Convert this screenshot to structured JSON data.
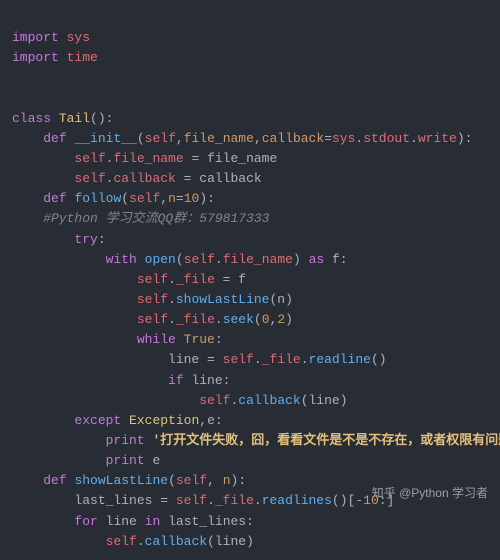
{
  "code": {
    "l1_kw1": "import",
    "l1_mod": "sys",
    "l2_kw1": "import",
    "l2_mod": "time",
    "l4_kw": "class",
    "l4_name": "Tail",
    "l4_p": "():",
    "l5_kw": "def",
    "l5_name": "__init__",
    "l5_sig1": "(",
    "l5_self": "self",
    "l5_c1": ",",
    "l5_p1": "file_name",
    "l5_c2": ",",
    "l5_p2": "callback",
    "l5_eq": "=",
    "l5_sys": "sys",
    "l5_d1": ".",
    "l5_stdout": "stdout",
    "l5_d2": ".",
    "l5_write": "write",
    "l5_end": "):",
    "l6_self": "self",
    "l6_d": ".",
    "l6_attr": "file_name",
    "l6_eq": " = ",
    "l6_val": "file_name",
    "l7_self": "self",
    "l7_d": ".",
    "l7_attr": "callback",
    "l7_eq": " = ",
    "l7_val": "callback",
    "l8_kw": "def",
    "l8_name": "follow",
    "l8_sig1": "(",
    "l8_self": "self",
    "l8_c": ",",
    "l8_p": "n",
    "l8_eq": "=",
    "l8_num": "10",
    "l8_end": "):",
    "l9_cmt": "#Python 学习交流QQ群：579817333",
    "l10_kw": "try",
    "l10_c": ":",
    "l11_kw1": "with",
    "l11_open": "open",
    "l11_p1": "(",
    "l11_self": "self",
    "l11_d": ".",
    "l11_attr": "file_name",
    "l11_p2": ")",
    "l11_kw2": "as",
    "l11_f": "f",
    "l11_c": ":",
    "l12_self": "self",
    "l12_d": ".",
    "l12_attr": "_file",
    "l12_eq": " = ",
    "l12_val": "f",
    "l13_self": "self",
    "l13_d": ".",
    "l13_fn": "showLastLine",
    "l13_p": "(n)",
    "l14_self": "self",
    "l14_d1": ".",
    "l14_attr": "_file",
    "l14_d2": ".",
    "l14_fn": "seek",
    "l14_p1": "(",
    "l14_n1": "0",
    "l14_c": ",",
    "l14_n2": "2",
    "l14_p2": ")",
    "l15_kw": "while",
    "l15_bool": "True",
    "l15_c": ":",
    "l16_var": "line",
    "l16_eq": " = ",
    "l16_self": "self",
    "l16_d1": ".",
    "l16_attr": "_file",
    "l16_d2": ".",
    "l16_fn": "readline",
    "l16_p": "()",
    "l17_kw": "if",
    "l17_var": "line",
    "l17_c": ":",
    "l18_self": "self",
    "l18_d": ".",
    "l18_fn": "callback",
    "l18_p": "(line)",
    "l19_kw": "except",
    "l19_ex": "Exception",
    "l19_c": ",",
    "l19_e": "e",
    "l19_col": ":",
    "l20_kw": "print",
    "l20_str": "'打开文件失败，囧，看看文件是不是不存在，或者权限有问题'",
    "l21_kw": "print",
    "l21_e": "e",
    "l22_kw": "def",
    "l22_name": "showLastLine",
    "l22_p1": "(",
    "l22_self": "self",
    "l22_c": ", ",
    "l22_p": "n",
    "l22_end": "):",
    "l23_var": "last_lines",
    "l23_eq": " = ",
    "l23_self": "self",
    "l23_d1": ".",
    "l23_attr": "_file",
    "l23_d2": ".",
    "l23_fn": "readlines",
    "l23_p": "()[-",
    "l23_num": "10",
    "l23_p2": ":]",
    "l24_kw": "for",
    "l24_var": "line",
    "l24_kw2": "in",
    "l24_it": "last_lines",
    "l24_c": ":",
    "l25_self": "self",
    "l25_d": ".",
    "l25_fn": "callback",
    "l25_p": "(line)"
  },
  "watermark": "知乎 @Python 学习者"
}
